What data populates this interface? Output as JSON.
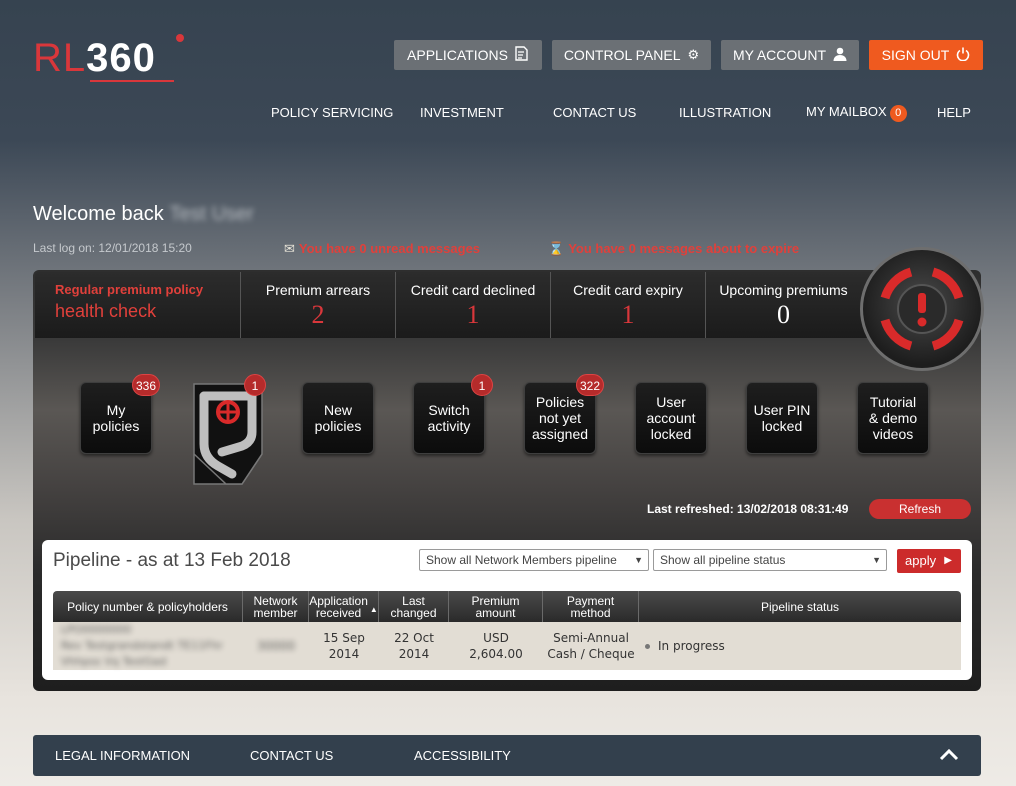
{
  "logo": {
    "rl": "RL",
    "num": "360"
  },
  "topbar": {
    "applications": "APPLICATIONS",
    "control_panel": "CONTROL PANEL",
    "my_account": "MY ACCOUNT",
    "sign_out": "SIGN OUT"
  },
  "nav": {
    "policy_servicing": "POLICY SERVICING",
    "investment": "INVESTMENT",
    "contact_us": "CONTACT US",
    "illustration": "ILLUSTRATION",
    "my_mailbox": "MY MAILBOX",
    "mailbox_count": "0",
    "help": "HELP"
  },
  "welcome": {
    "prefix": "Welcome back",
    "user": "Test User"
  },
  "last_logon": "Last log on: 12/01/2018 15:20",
  "messages": {
    "unread": "You have 0 unread messages",
    "expiring": "You have 0 messages about to expire"
  },
  "health_check": {
    "label": "Regular premium policy",
    "sub": "health check",
    "cells": [
      {
        "label": "Premium arrears",
        "value": "2"
      },
      {
        "label": "Credit card declined",
        "value": "1"
      },
      {
        "label": "Credit card expiry",
        "value": "1"
      },
      {
        "label": "Upcoming premiums",
        "value": "0"
      }
    ]
  },
  "tiles": [
    {
      "label": "My policies",
      "badge": "336"
    },
    {
      "label": "",
      "badge": "1"
    },
    {
      "label": "New policies",
      "badge": ""
    },
    {
      "label": "Switch activity",
      "badge": "1"
    },
    {
      "label": "Policies not yet assigned",
      "badge": "322"
    },
    {
      "label": "User account locked",
      "badge": ""
    },
    {
      "label": "User PIN locked",
      "badge": ""
    },
    {
      "label": "Tutorial & demo videos",
      "badge": ""
    }
  ],
  "refresh": {
    "last": "Last refreshed: 13/02/2018 08:31:49",
    "button": "Refresh"
  },
  "pipeline": {
    "title": "Pipeline - as at 13 Feb 2018",
    "filter_members": "Show all Network Members pipeline",
    "filter_status": "Show all pipeline status",
    "apply": "apply",
    "columns": {
      "policy": "Policy number & policyholders",
      "network": "Network member",
      "received": "Application received",
      "changed": "Last changed",
      "premium": "Premium amount",
      "method": "Payment method",
      "status": "Pipeline status"
    },
    "rows": [
      {
        "policy_line1": "LPO0000000",
        "policy_line2": "Rev Testgrandstandt TE11Fhr",
        "policy_line3": "Vhhpss Vq TestGad",
        "network": "30000",
        "received_line1": "15 Sep",
        "received_line2": "2014",
        "changed_line1": "22 Oct",
        "changed_line2": "2014",
        "premium_line1": "USD",
        "premium_line2": "2,604.00",
        "method_line1": "Semi-Annual",
        "method_line2": "Cash / Cheque",
        "status": "In progress"
      }
    ]
  },
  "footer": {
    "legal": "LEGAL INFORMATION",
    "contact": "CONTACT US",
    "accessibility": "ACCESSIBILITY"
  }
}
